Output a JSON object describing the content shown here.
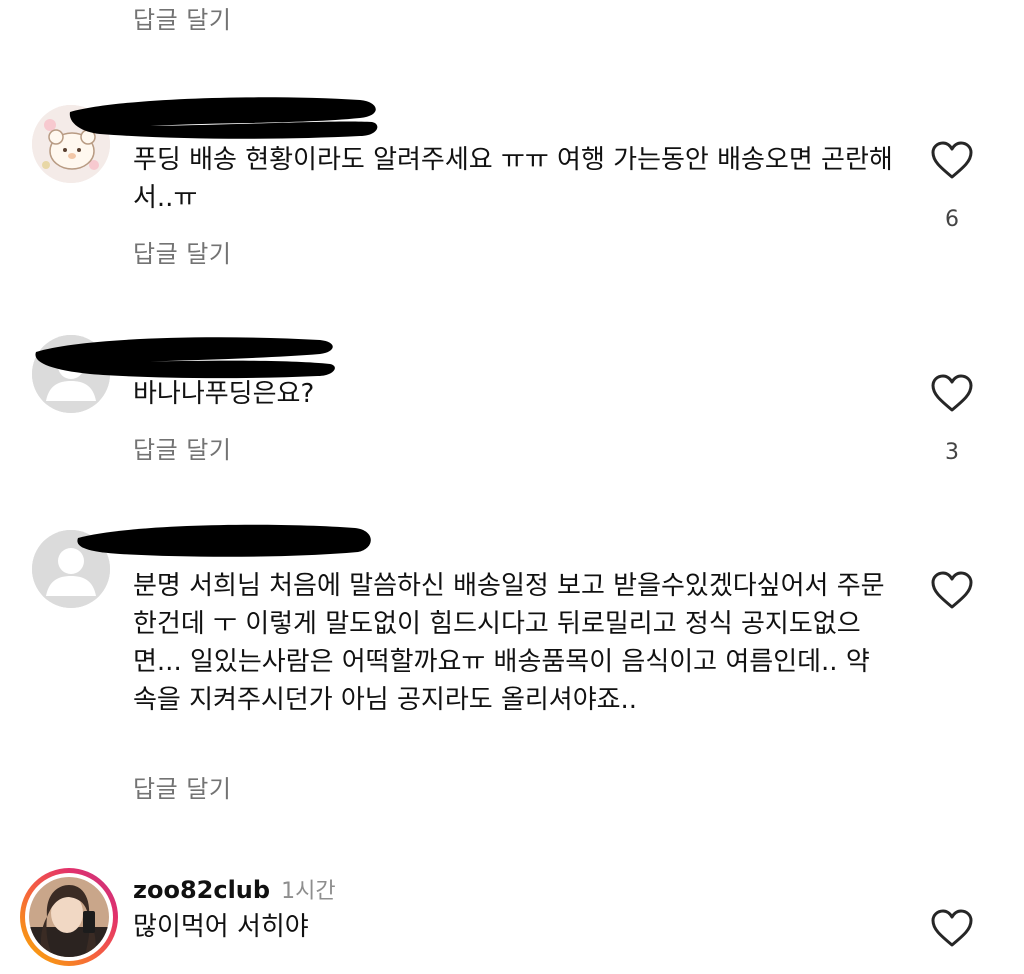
{
  "reply_label": "답글 달기",
  "comments": [
    {
      "text": "푸딩 배송 현황이라도 알려주세요 ㅠㅠ 여행 가는동안 배송오면 곤란해서..ㅠ",
      "likes": "6"
    },
    {
      "text": "바나나푸딩은요?",
      "likes": "3"
    },
    {
      "text": "분명 서희님 처음에 말씀하신 배송일정 보고 받을수있겠다싶어서 주문한건데 ㅜ 이렇게 말도없이 힘드시다고 뒤로밀리고 정식 공지도없으면...  일있는사람은 어떡할까요ㅠ 배송품목이 음식이고 여름인데.. 약속을 지켜주시던가 아님 공지라도 올리셔야죠..",
      "likes": ""
    },
    {
      "username": "zoo82club",
      "time": "1시간",
      "text": "많이먹어 서히야",
      "likes": ""
    }
  ],
  "colors": {
    "text": "#111111",
    "secondary": "#737373",
    "story_ring_start": "#f9b000",
    "story_ring_end": "#e1306c"
  }
}
